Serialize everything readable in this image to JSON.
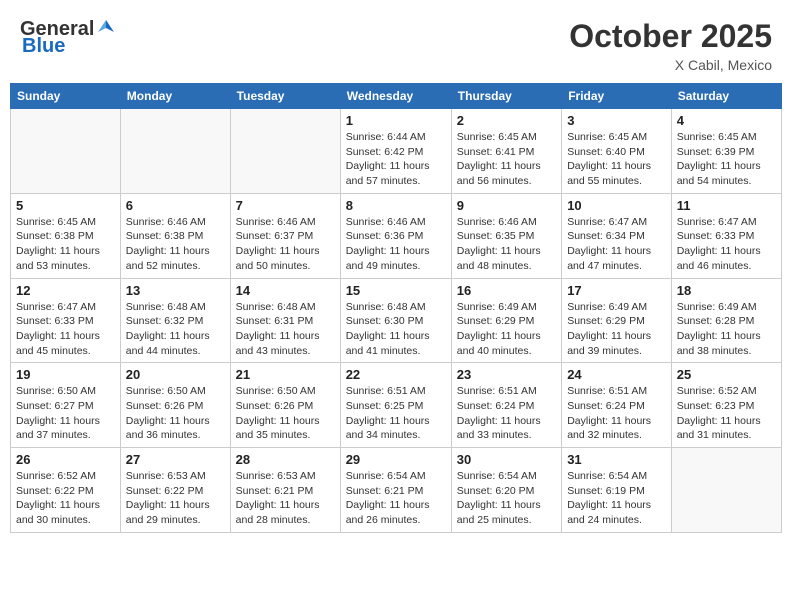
{
  "header": {
    "logo_general": "General",
    "logo_blue": "Blue",
    "month": "October 2025",
    "location": "X Cabil, Mexico"
  },
  "days_of_week": [
    "Sunday",
    "Monday",
    "Tuesday",
    "Wednesday",
    "Thursday",
    "Friday",
    "Saturday"
  ],
  "weeks": [
    [
      {
        "day": "",
        "info": ""
      },
      {
        "day": "",
        "info": ""
      },
      {
        "day": "",
        "info": ""
      },
      {
        "day": "1",
        "info": "Sunrise: 6:44 AM\nSunset: 6:42 PM\nDaylight: 11 hours\nand 57 minutes."
      },
      {
        "day": "2",
        "info": "Sunrise: 6:45 AM\nSunset: 6:41 PM\nDaylight: 11 hours\nand 56 minutes."
      },
      {
        "day": "3",
        "info": "Sunrise: 6:45 AM\nSunset: 6:40 PM\nDaylight: 11 hours\nand 55 minutes."
      },
      {
        "day": "4",
        "info": "Sunrise: 6:45 AM\nSunset: 6:39 PM\nDaylight: 11 hours\nand 54 minutes."
      }
    ],
    [
      {
        "day": "5",
        "info": "Sunrise: 6:45 AM\nSunset: 6:38 PM\nDaylight: 11 hours\nand 53 minutes."
      },
      {
        "day": "6",
        "info": "Sunrise: 6:46 AM\nSunset: 6:38 PM\nDaylight: 11 hours\nand 52 minutes."
      },
      {
        "day": "7",
        "info": "Sunrise: 6:46 AM\nSunset: 6:37 PM\nDaylight: 11 hours\nand 50 minutes."
      },
      {
        "day": "8",
        "info": "Sunrise: 6:46 AM\nSunset: 6:36 PM\nDaylight: 11 hours\nand 49 minutes."
      },
      {
        "day": "9",
        "info": "Sunrise: 6:46 AM\nSunset: 6:35 PM\nDaylight: 11 hours\nand 48 minutes."
      },
      {
        "day": "10",
        "info": "Sunrise: 6:47 AM\nSunset: 6:34 PM\nDaylight: 11 hours\nand 47 minutes."
      },
      {
        "day": "11",
        "info": "Sunrise: 6:47 AM\nSunset: 6:33 PM\nDaylight: 11 hours\nand 46 minutes."
      }
    ],
    [
      {
        "day": "12",
        "info": "Sunrise: 6:47 AM\nSunset: 6:33 PM\nDaylight: 11 hours\nand 45 minutes."
      },
      {
        "day": "13",
        "info": "Sunrise: 6:48 AM\nSunset: 6:32 PM\nDaylight: 11 hours\nand 44 minutes."
      },
      {
        "day": "14",
        "info": "Sunrise: 6:48 AM\nSunset: 6:31 PM\nDaylight: 11 hours\nand 43 minutes."
      },
      {
        "day": "15",
        "info": "Sunrise: 6:48 AM\nSunset: 6:30 PM\nDaylight: 11 hours\nand 41 minutes."
      },
      {
        "day": "16",
        "info": "Sunrise: 6:49 AM\nSunset: 6:29 PM\nDaylight: 11 hours\nand 40 minutes."
      },
      {
        "day": "17",
        "info": "Sunrise: 6:49 AM\nSunset: 6:29 PM\nDaylight: 11 hours\nand 39 minutes."
      },
      {
        "day": "18",
        "info": "Sunrise: 6:49 AM\nSunset: 6:28 PM\nDaylight: 11 hours\nand 38 minutes."
      }
    ],
    [
      {
        "day": "19",
        "info": "Sunrise: 6:50 AM\nSunset: 6:27 PM\nDaylight: 11 hours\nand 37 minutes."
      },
      {
        "day": "20",
        "info": "Sunrise: 6:50 AM\nSunset: 6:26 PM\nDaylight: 11 hours\nand 36 minutes."
      },
      {
        "day": "21",
        "info": "Sunrise: 6:50 AM\nSunset: 6:26 PM\nDaylight: 11 hours\nand 35 minutes."
      },
      {
        "day": "22",
        "info": "Sunrise: 6:51 AM\nSunset: 6:25 PM\nDaylight: 11 hours\nand 34 minutes."
      },
      {
        "day": "23",
        "info": "Sunrise: 6:51 AM\nSunset: 6:24 PM\nDaylight: 11 hours\nand 33 minutes."
      },
      {
        "day": "24",
        "info": "Sunrise: 6:51 AM\nSunset: 6:24 PM\nDaylight: 11 hours\nand 32 minutes."
      },
      {
        "day": "25",
        "info": "Sunrise: 6:52 AM\nSunset: 6:23 PM\nDaylight: 11 hours\nand 31 minutes."
      }
    ],
    [
      {
        "day": "26",
        "info": "Sunrise: 6:52 AM\nSunset: 6:22 PM\nDaylight: 11 hours\nand 30 minutes."
      },
      {
        "day": "27",
        "info": "Sunrise: 6:53 AM\nSunset: 6:22 PM\nDaylight: 11 hours\nand 29 minutes."
      },
      {
        "day": "28",
        "info": "Sunrise: 6:53 AM\nSunset: 6:21 PM\nDaylight: 11 hours\nand 28 minutes."
      },
      {
        "day": "29",
        "info": "Sunrise: 6:54 AM\nSunset: 6:21 PM\nDaylight: 11 hours\nand 26 minutes."
      },
      {
        "day": "30",
        "info": "Sunrise: 6:54 AM\nSunset: 6:20 PM\nDaylight: 11 hours\nand 25 minutes."
      },
      {
        "day": "31",
        "info": "Sunrise: 6:54 AM\nSunset: 6:19 PM\nDaylight: 11 hours\nand 24 minutes."
      },
      {
        "day": "",
        "info": ""
      }
    ]
  ]
}
